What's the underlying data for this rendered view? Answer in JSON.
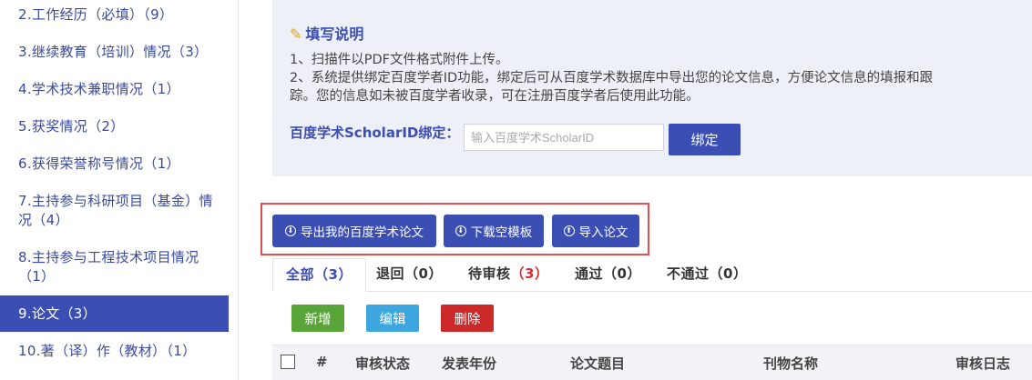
{
  "sidebar": {
    "items": [
      {
        "label": "2.工作经历（必填）（9）"
      },
      {
        "label": "3.继续教育（培训）情况（3）"
      },
      {
        "label": "4.学术技术兼职情况（1）"
      },
      {
        "label": "5.获奖情况（2）"
      },
      {
        "label": "6.获得荣誉称号情况（1）"
      },
      {
        "label": "7.主持参与科研项目（基金）情",
        "label2": "况（4）"
      },
      {
        "label": "8.主持参与工程技术项目情况",
        "label2": "（1）"
      },
      {
        "label": "9.论文（3）",
        "active": true
      },
      {
        "label": "10.著（译）作（教材）（1）"
      }
    ]
  },
  "notice": {
    "title": "填写说明",
    "line1": "1、扫描件以PDF文件格式附件上传。",
    "line2": "2、系统提供绑定百度学者ID功能，绑定后可从百度学术数据库中导出您的论文信息，方便论文信息的填报和跟",
    "line3": "踪。您的信息如未被百度学者收录，可在注册百度学者后使用此功能。",
    "bind_label": "百度学术ScholarID绑定：",
    "bind_placeholder": "输入百度学术ScholarID",
    "bind_button": "绑定"
  },
  "actions": {
    "export": "导出我的百度学术论文",
    "download": "下载空模板",
    "import": "导入论文"
  },
  "tabs": [
    {
      "name": "全部",
      "count": "（3）"
    },
    {
      "name": "退回",
      "count": "（0）"
    },
    {
      "name": "待审核",
      "count": "（3）"
    },
    {
      "name": "通过",
      "count": "（0）"
    },
    {
      "name": "不通过",
      "count": "（0）"
    }
  ],
  "crud": {
    "add": "新增",
    "edit": "编辑",
    "delete": "删除"
  },
  "table": {
    "headers": [
      "#",
      "审核状态",
      "发表年份",
      "论文题目",
      "刊物名称",
      "审核日志"
    ]
  },
  "colors": {
    "primary": "#3b4eb3",
    "add": "#5aa53a",
    "edit": "#3ea6de",
    "delete": "#cc2a2a",
    "highlight": "#e05050"
  }
}
